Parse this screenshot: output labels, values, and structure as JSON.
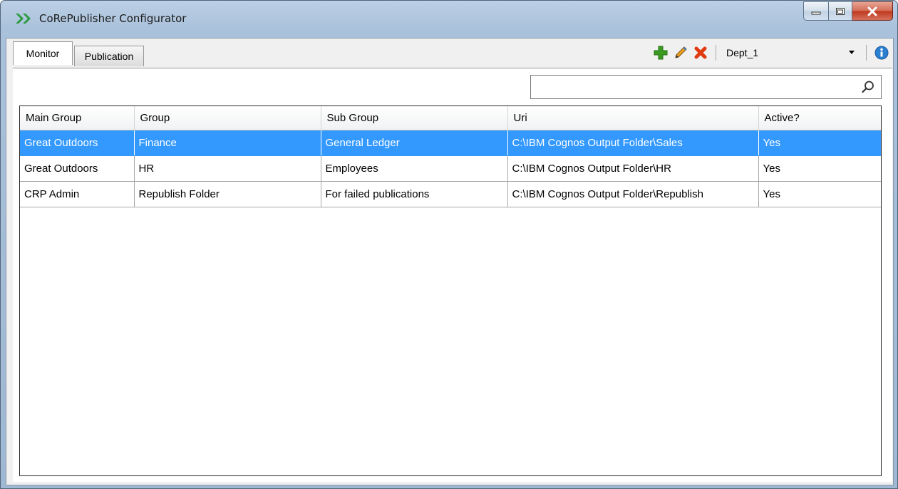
{
  "window": {
    "title": "CoRePublisher Configurator",
    "icons": [
      "app-chevron-icon",
      "minimize-icon",
      "maximize-icon",
      "close-icon"
    ]
  },
  "tabs": [
    {
      "label": "Monitor",
      "active": true
    },
    {
      "label": "Publication",
      "active": false
    }
  ],
  "toolbar": {
    "icons": [
      "add-icon",
      "edit-icon",
      "delete-icon",
      "info-icon"
    ],
    "dept_value": "Dept_1"
  },
  "search": {
    "value": "",
    "placeholder": ""
  },
  "table": {
    "columns": [
      "Main Group",
      "Group",
      "Sub Group",
      "Uri",
      "Active?"
    ],
    "rows": [
      {
        "main_group": "Great Outdoors",
        "group": "Finance",
        "sub_group": "General Ledger",
        "uri": "C:\\IBM Cognos Output Folder\\Sales",
        "active": "Yes",
        "selected": true
      },
      {
        "main_group": "Great Outdoors",
        "group": "HR",
        "sub_group": "Employees",
        "uri": "C:\\IBM Cognos Output Folder\\HR",
        "active": "Yes",
        "selected": false
      },
      {
        "main_group": "CRP Admin",
        "group": "Republish Folder",
        "sub_group": "For failed publications",
        "uri": "C:\\IBM Cognos Output Folder\\Republish",
        "active": "Yes",
        "selected": false
      }
    ]
  },
  "colors": {
    "selection": "#3399ff",
    "add": "#3a9b20",
    "delete": "#e03a10",
    "info": "#2a7fd0",
    "app_icon": "#2a9a3c"
  }
}
